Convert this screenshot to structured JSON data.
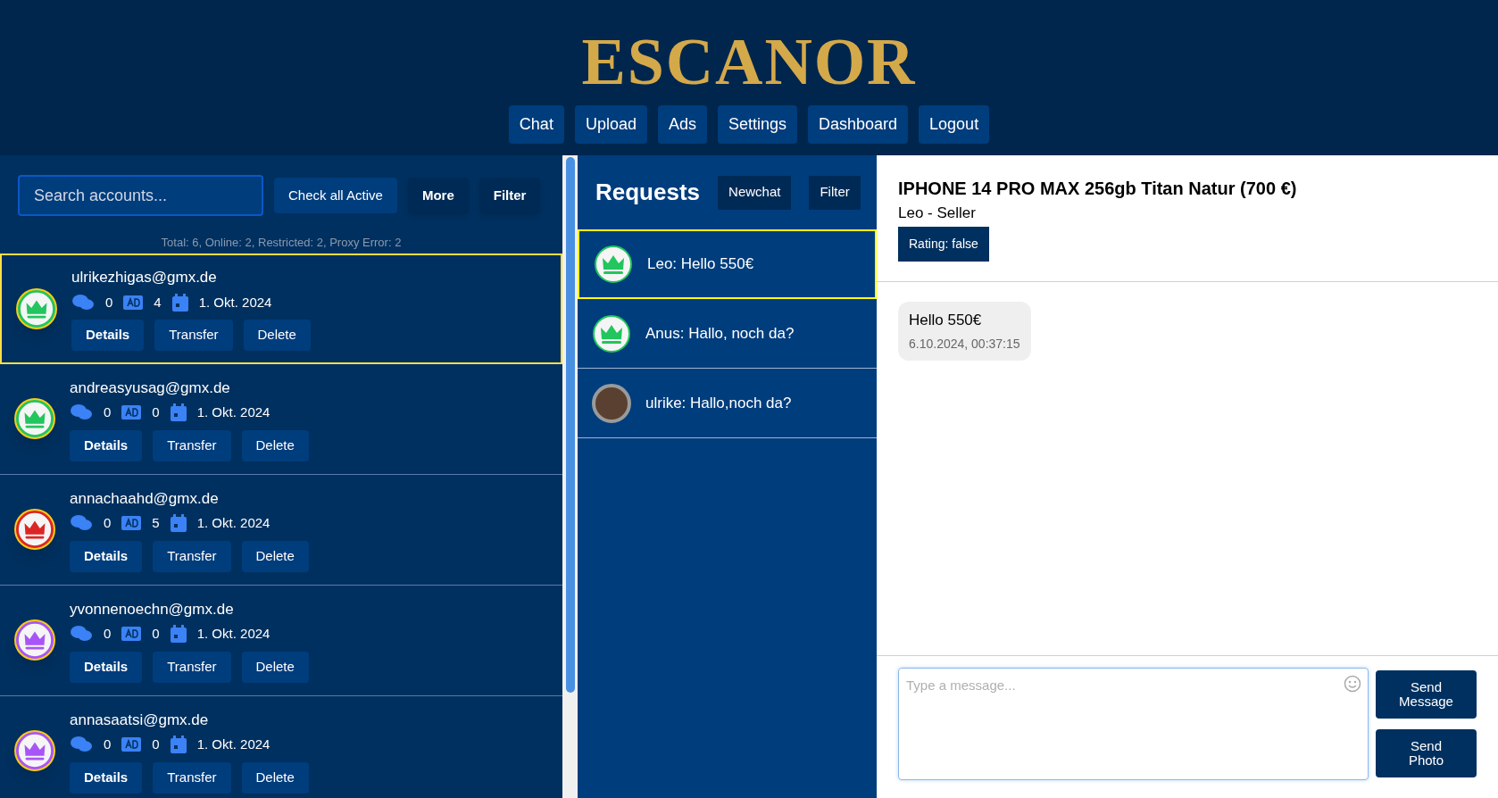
{
  "header": {
    "logo": "ESCANOR",
    "nav": [
      {
        "label": "Chat"
      },
      {
        "label": "Upload"
      },
      {
        "label": "Ads"
      },
      {
        "label": "Settings"
      },
      {
        "label": "Dashboard"
      },
      {
        "label": "Logout"
      }
    ]
  },
  "accounts_panel": {
    "search": {
      "placeholder": "Search accounts..."
    },
    "buttons": [
      {
        "label": "Check all Active",
        "kind": "plain"
      },
      {
        "label": "More",
        "kind": "bold"
      },
      {
        "label": "Filter",
        "kind": "bold"
      }
    ],
    "summary": "Total: 6, Online: 2, Restricted: 2, Proxy Error: 2",
    "accounts": [
      {
        "email": "ulrikezhigas@gmx.de",
        "color": "#22c55e",
        "chats": "0",
        "ads": "4",
        "date": "1. Okt. 2024",
        "selected": true,
        "actions": [
          "Details",
          "Transfer",
          "Delete"
        ]
      },
      {
        "email": "andreasyusag@gmx.de",
        "color": "#22c55e",
        "chats": "0",
        "ads": "0",
        "date": "1. Okt. 2024",
        "selected": false,
        "actions": [
          "Details",
          "Transfer",
          "Delete"
        ]
      },
      {
        "email": "annachaahd@gmx.de",
        "color": "#dc2626",
        "chats": "0",
        "ads": "5",
        "date": "1. Okt. 2024",
        "selected": false,
        "actions": [
          "Details",
          "Transfer",
          "Delete"
        ]
      },
      {
        "email": "yvonnenoechn@gmx.de",
        "color": "#a855f7",
        "chats": "0",
        "ads": "0",
        "date": "1. Okt. 2024",
        "selected": false,
        "actions": [
          "Details",
          "Transfer",
          "Delete"
        ]
      },
      {
        "email": "annasaatsi@gmx.de",
        "color": "#a855f7",
        "chats": "0",
        "ads": "0",
        "date": "1. Okt. 2024",
        "selected": false,
        "actions": [
          "Details",
          "Transfer",
          "Delete"
        ]
      }
    ]
  },
  "requests_panel": {
    "title": "Requests",
    "buttons": [
      "Newchat",
      "Filter"
    ],
    "requests": [
      {
        "text": "Leo: Hello 550€",
        "kind": "crown",
        "selected": true
      },
      {
        "text": "Anus: Hallo, noch da?",
        "kind": "crown",
        "selected": false
      },
      {
        "text": "ulrike: Hallo,noch da?",
        "kind": "photo",
        "selected": false
      }
    ]
  },
  "chat": {
    "title": "IPHONE 14 PRO MAX 256gb Titan Natur (700 €)",
    "subtitle": "Leo - Seller",
    "rating": "Rating: false",
    "messages": [
      {
        "text": "Hello 550€",
        "time": "6.10.2024, 00:37:15"
      }
    ],
    "input": {
      "placeholder": "Type a message..."
    },
    "buttons": [
      "Send Message",
      "Send Photo"
    ]
  }
}
